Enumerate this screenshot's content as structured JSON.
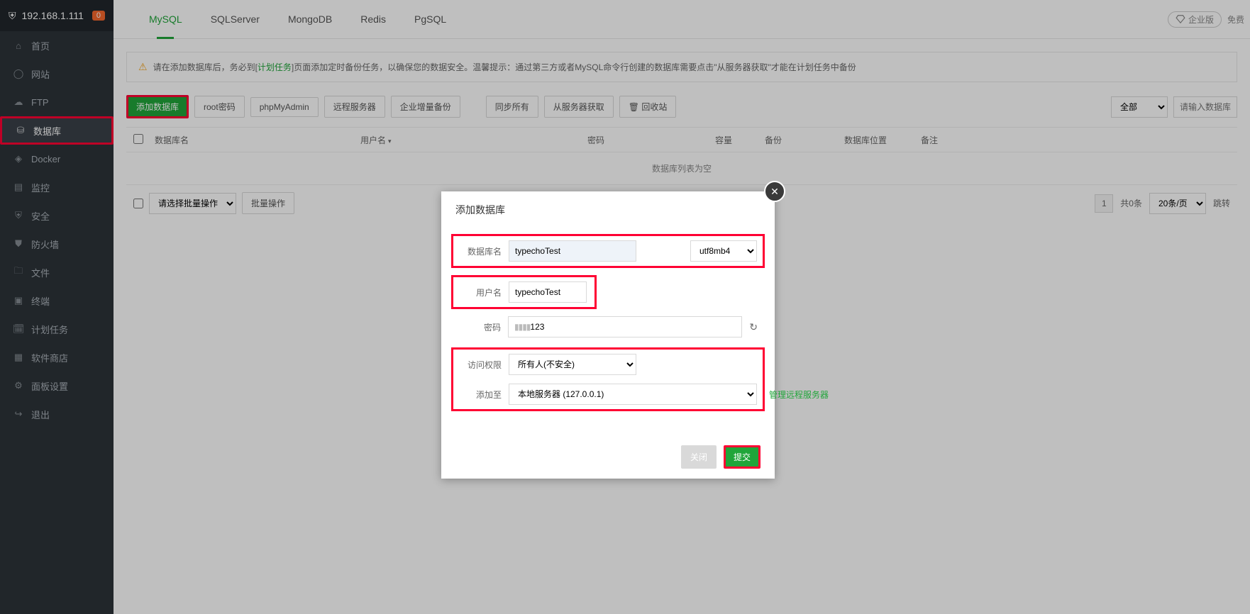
{
  "sidebar": {
    "ip": "192.168.1.111",
    "badge": "0",
    "items": [
      {
        "icon": "home",
        "label": "首页"
      },
      {
        "icon": "globe",
        "label": "网站"
      },
      {
        "icon": "cloud",
        "label": "FTP"
      },
      {
        "icon": "db",
        "label": "数据库"
      },
      {
        "icon": "docker",
        "label": "Docker"
      },
      {
        "icon": "monitor",
        "label": "监控"
      },
      {
        "icon": "shield",
        "label": "安全"
      },
      {
        "icon": "firewall",
        "label": "防火墙"
      },
      {
        "icon": "folder",
        "label": "文件"
      },
      {
        "icon": "terminal",
        "label": "终端"
      },
      {
        "icon": "schedule",
        "label": "计划任务"
      },
      {
        "icon": "apps",
        "label": "软件商店"
      },
      {
        "icon": "gear",
        "label": "面板设置"
      },
      {
        "icon": "exit",
        "label": "退出"
      }
    ]
  },
  "tabs": {
    "items": [
      "MySQL",
      "SQLServer",
      "MongoDB",
      "Redis",
      "PgSQL"
    ],
    "enterprise_label": "企业版",
    "free_label": "免费"
  },
  "tip": {
    "pre": "请在添加数据库后，务必到[",
    "link": "计划任务",
    "post": "]页面添加定时备份任务，以确保您的数据安全。温馨提示：通过第三方或者MySQL命令行创建的数据库需要点击\"从服务器获取\"才能在计划任务中备份"
  },
  "toolbar": {
    "add": "添加数据库",
    "root": "root密码",
    "pma": "phpMyAdmin",
    "remote": "远程服务器",
    "backup": "企业增量备份",
    "sync_all": "同步所有",
    "fetch": "从服务器获取",
    "trash": "回收站",
    "filter_all": "全部",
    "search_placeholder": "请输入数据库名称"
  },
  "table": {
    "cols": {
      "name": "数据库名",
      "user": "用户名",
      "pwd": "密码",
      "cap": "容量",
      "backup": "备份",
      "loc": "数据库位置",
      "note": "备注"
    },
    "empty": "数据库列表为空"
  },
  "batch": {
    "select_placeholder": "请选择批量操作",
    "btn": "批量操作"
  },
  "pager": {
    "current": "1",
    "total_label": "共0条",
    "per_page": "20条/页",
    "jump": "跳转"
  },
  "modal": {
    "title": "添加数据库",
    "labels": {
      "dbname": "数据库名",
      "username": "用户名",
      "password": "密码",
      "access": "访问权限",
      "addto": "添加至"
    },
    "values": {
      "dbname": "typechoTest",
      "username": "typechoTest",
      "password_suffix": "123",
      "charset": "utf8mb4",
      "access": "所有人(不安全)",
      "addto": "本地服务器 (127.0.0.1)"
    },
    "manage_remote": "管理远程服务器",
    "close": "关闭",
    "submit": "提交"
  },
  "icons": {
    "home": "⌂",
    "globe": "◯",
    "cloud": "☁",
    "db": "⛁",
    "docker": "🐳",
    "monitor": "▤",
    "shield": "⛨",
    "firewall": "⛊",
    "folder": "🗀",
    "terminal": "▣",
    "schedule": "🗓",
    "apps": "▦",
    "gear": "⚙",
    "exit": "↪"
  }
}
